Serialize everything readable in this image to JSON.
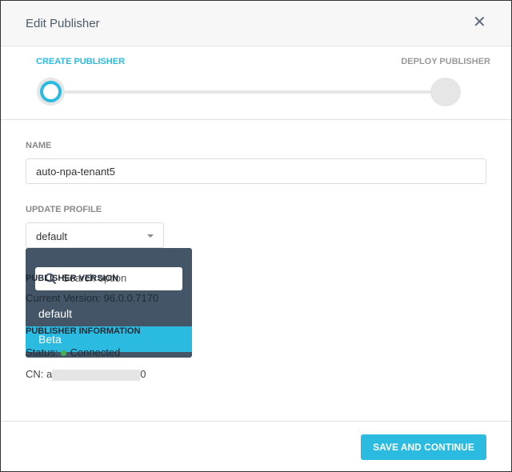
{
  "dialog": {
    "title": "Edit Publisher",
    "close_icon": "close-icon"
  },
  "steps": {
    "step1": "CREATE PUBLISHER",
    "step2": "DEPLOY PUBLISHER",
    "active": 1
  },
  "form": {
    "name_label": "NAME",
    "name_value": "auto-npa-tenant5",
    "profile_label": "UPDATE PROFILE",
    "profile_value": "default",
    "version_label": "PUBLISHER VERSION",
    "current_version": "Current Version: 96.0.0.7170",
    "info_label": "PUBLISHER INFORMATION",
    "status_label": "Status:",
    "status_value": "Connected",
    "cn_label": "CN: a",
    "cn_suffix": "0"
  },
  "dropdown": {
    "search_placeholder": "Search option",
    "options": [
      "default",
      "Beta"
    ],
    "highlighted": "Beta"
  },
  "footer": {
    "save_label": "SAVE AND CONTINUE"
  },
  "colors": {
    "accent": "#2bbbe0",
    "dropdown_bg": "#3a4c60"
  }
}
